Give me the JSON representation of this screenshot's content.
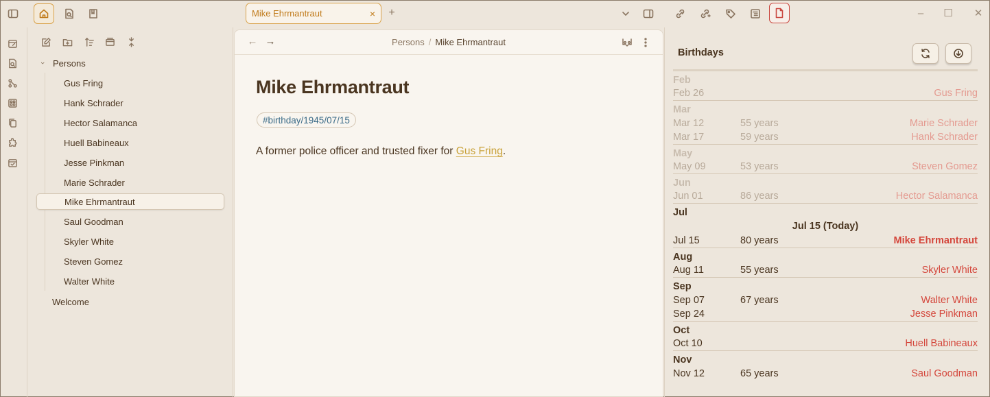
{
  "tab": {
    "title": "Mike Ehrmantraut",
    "close": "×",
    "new_tab": "+"
  },
  "window_controls": {
    "minimize": "–",
    "maximize": "☐",
    "close": "✕"
  },
  "explorer": {
    "folder": "Persons",
    "files": [
      "Gus Fring",
      "Hank Schrader",
      "Hector Salamanca",
      "Huell Babineaux",
      "Jesse Pinkman",
      "Marie Schrader",
      "Mike Ehrmantraut",
      "Saul Goodman",
      "Skyler White",
      "Steven Gomez",
      "Walter White"
    ],
    "selected": "Mike Ehrmantraut",
    "root_files": [
      "Welcome"
    ]
  },
  "editor": {
    "breadcrumb_folder": "Persons",
    "breadcrumb_sep": "/",
    "breadcrumb_current": "Mike Ehrmantraut",
    "title": "Mike Ehrmantraut",
    "tag": "#birthday/1945/07/15",
    "body_prefix": "A former police officer and trusted fixer for ",
    "body_link": "Gus Fring",
    "body_suffix": "."
  },
  "birthdays": {
    "title": "Birthdays",
    "today_label": "Jul 15 (Today)",
    "months": [
      {
        "name": "Feb",
        "past": true,
        "entries": [
          {
            "date": "Feb 26",
            "age": "",
            "name": "Gus Fring"
          }
        ]
      },
      {
        "name": "Mar",
        "past": true,
        "entries": [
          {
            "date": "Mar 12",
            "age": "55 years",
            "name": "Marie Schrader"
          },
          {
            "date": "Mar 17",
            "age": "59 years",
            "name": "Hank Schrader"
          }
        ]
      },
      {
        "name": "May",
        "past": true,
        "entries": [
          {
            "date": "May 09",
            "age": "53 years",
            "name": "Steven Gomez"
          }
        ]
      },
      {
        "name": "Jun",
        "past": true,
        "entries": [
          {
            "date": "Jun 01",
            "age": "86 years",
            "name": "Hector Salamanca"
          }
        ]
      },
      {
        "name": "Jul",
        "past": false,
        "today": true,
        "entries": [
          {
            "date": "Jul 15",
            "age": "80 years",
            "name": "Mike Ehrmantraut"
          }
        ]
      },
      {
        "name": "Aug",
        "past": false,
        "entries": [
          {
            "date": "Aug 11",
            "age": "55 years",
            "name": "Skyler White"
          }
        ]
      },
      {
        "name": "Sep",
        "past": false,
        "entries": [
          {
            "date": "Sep 07",
            "age": "67 years",
            "name": "Walter White"
          },
          {
            "date": "Sep 24",
            "age": "",
            "name": "Jesse Pinkman"
          }
        ]
      },
      {
        "name": "Oct",
        "past": false,
        "entries": [
          {
            "date": "Oct 10",
            "age": "",
            "name": "Huell Babineaux"
          }
        ]
      },
      {
        "name": "Nov",
        "past": false,
        "entries": [
          {
            "date": "Nov 12",
            "age": "65 years",
            "name": "Saul Goodman"
          }
        ]
      }
    ]
  },
  "colors": {
    "accent": "#d9a24a",
    "birthday_name": "#d4463b",
    "tag": "#3b6b88",
    "link": "#c9a23a"
  }
}
